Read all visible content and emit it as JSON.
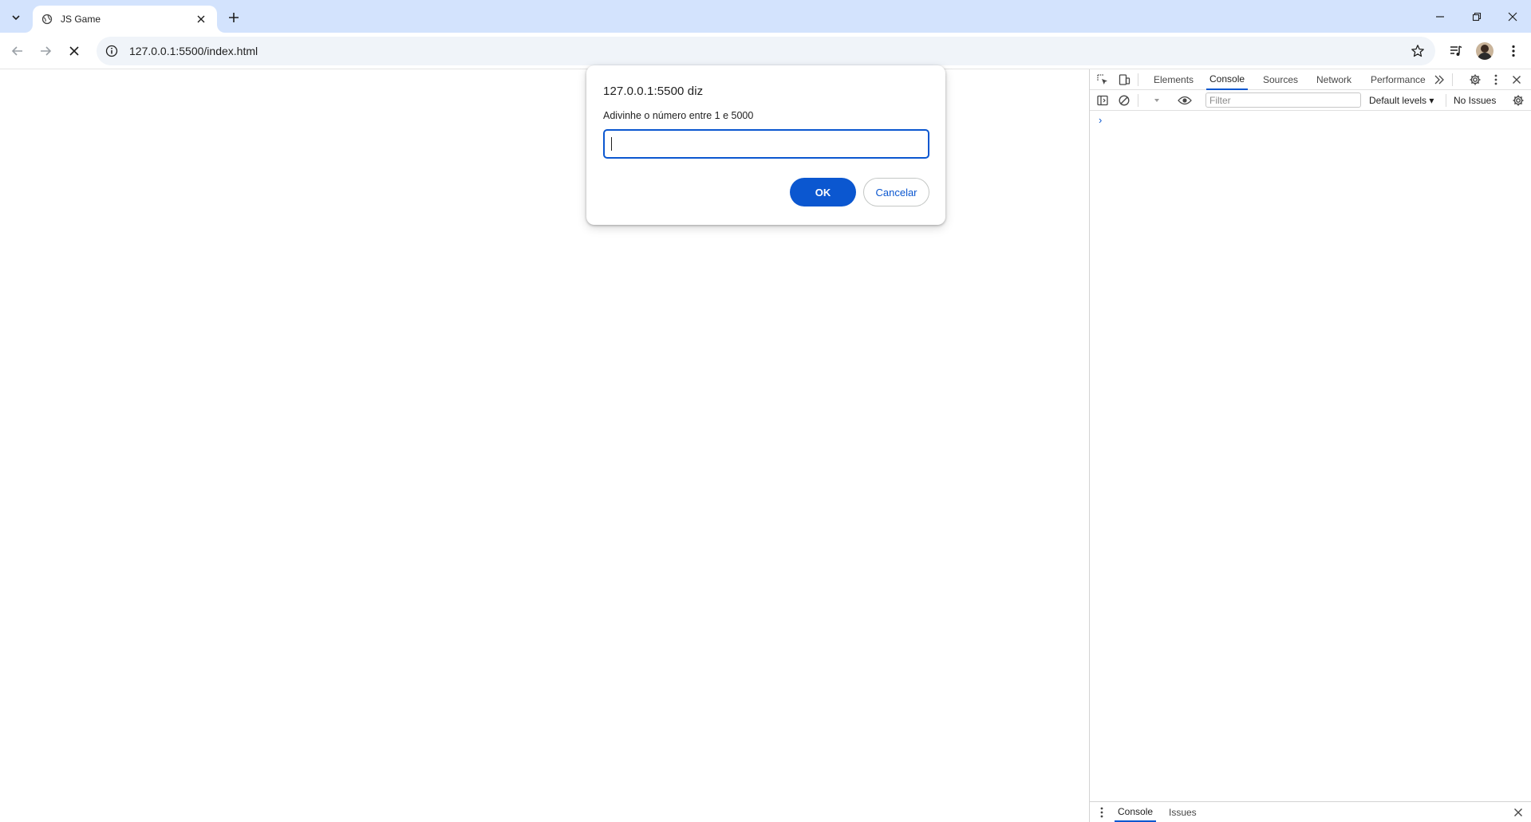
{
  "tab": {
    "title": "JS Game"
  },
  "address_bar": {
    "url": "127.0.0.1:5500/index.html"
  },
  "dialog": {
    "title": "127.0.0.1:5500 diz",
    "message": "Adivinhe o número entre 1 e 5000",
    "input_value": "",
    "ok_label": "OK",
    "cancel_label": "Cancelar"
  },
  "devtools": {
    "tabs": [
      {
        "label": "Elements"
      },
      {
        "label": "Console",
        "active": true
      },
      {
        "label": "Sources"
      },
      {
        "label": "Network"
      },
      {
        "label": "Performance"
      }
    ],
    "filter_placeholder": "Filter",
    "levels_label": "Default levels ▾",
    "issues_label": "No Issues",
    "prompt_symbol": "›",
    "drawer_tabs": [
      {
        "label": "Console",
        "active": true
      },
      {
        "label": "Issues"
      }
    ]
  },
  "colors": {
    "tabstrip": "#d3e3fd",
    "accent": "#0b57d0",
    "omnibox": "#f0f4f9"
  }
}
